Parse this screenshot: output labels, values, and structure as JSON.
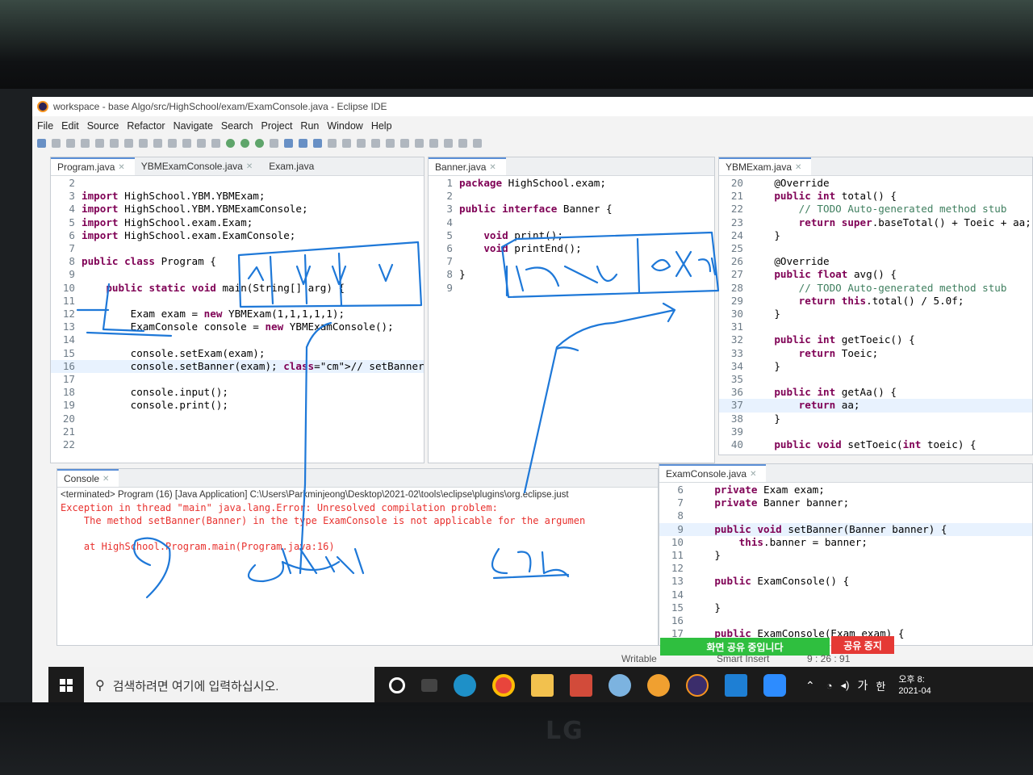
{
  "window": {
    "title": "workspace - base Algo/src/HighSchool/exam/ExamConsole.java - Eclipse IDE"
  },
  "menu": [
    "File",
    "Edit",
    "Source",
    "Refactor",
    "Navigate",
    "Search",
    "Project",
    "Run",
    "Window",
    "Help"
  ],
  "left_editor": {
    "tabs": [
      "Program.java",
      "YBMExamConsole.java",
      "Exam.java"
    ],
    "lines": [
      {
        "n": "2",
        "t": ""
      },
      {
        "n": "3",
        "t": "import HighSchool.YBM.YBMExam;"
      },
      {
        "n": "4",
        "t": "import HighSchool.YBM.YBMExamConsole;"
      },
      {
        "n": "5",
        "t": "import HighSchool.exam.Exam;"
      },
      {
        "n": "6",
        "t": "import HighSchool.exam.ExamConsole;"
      },
      {
        "n": "7",
        "t": ""
      },
      {
        "n": "8",
        "t": "public class Program {"
      },
      {
        "n": "9",
        "t": ""
      },
      {
        "n": "10",
        "t": "    public static void main(String[] arg) {"
      },
      {
        "n": "11",
        "t": ""
      },
      {
        "n": "12",
        "t": "        Exam exam = new YBMExam(1,1,1,1,1);"
      },
      {
        "n": "13",
        "t": "        ExamConsole console = new YBMExamConsole();"
      },
      {
        "n": "14",
        "t": ""
      },
      {
        "n": "15",
        "t": "        console.setExam(exam);"
      },
      {
        "n": "16",
        "t": "        console.setBanner(exam); // setBanner에 exam을"
      },
      {
        "n": "17",
        "t": ""
      },
      {
        "n": "18",
        "t": "        console.input();"
      },
      {
        "n": "19",
        "t": "        console.print();"
      },
      {
        "n": "20",
        "t": ""
      },
      {
        "n": "21",
        "t": ""
      },
      {
        "n": "22",
        "t": ""
      }
    ]
  },
  "mid_editor": {
    "tabs": [
      "Banner.java"
    ],
    "lines": [
      {
        "n": "1",
        "t": "package HighSchool.exam;"
      },
      {
        "n": "2",
        "t": ""
      },
      {
        "n": "3",
        "t": "public interface Banner {"
      },
      {
        "n": "4",
        "t": ""
      },
      {
        "n": "5",
        "t": "    void print();"
      },
      {
        "n": "6",
        "t": "    void printEnd();"
      },
      {
        "n": "7",
        "t": ""
      },
      {
        "n": "8",
        "t": "}"
      },
      {
        "n": "9",
        "t": ""
      }
    ]
  },
  "right_editor": {
    "tabs": [
      "YBMExam.java"
    ],
    "lines": [
      {
        "n": "20",
        "t": "    @Override"
      },
      {
        "n": "21",
        "t": "    public int total() {"
      },
      {
        "n": "22",
        "t": "        // TODO Auto-generated method stub"
      },
      {
        "n": "23",
        "t": "        return super.baseTotal() + Toeic + aa;"
      },
      {
        "n": "24",
        "t": "    }"
      },
      {
        "n": "25",
        "t": ""
      },
      {
        "n": "26",
        "t": "    @Override"
      },
      {
        "n": "27",
        "t": "    public float avg() {"
      },
      {
        "n": "28",
        "t": "        // TODO Auto-generated method stub"
      },
      {
        "n": "29",
        "t": "        return this.total() / 5.0f;"
      },
      {
        "n": "30",
        "t": "    }"
      },
      {
        "n": "31",
        "t": ""
      },
      {
        "n": "32",
        "t": "    public int getToeic() {"
      },
      {
        "n": "33",
        "t": "        return Toeic;"
      },
      {
        "n": "34",
        "t": "    }"
      },
      {
        "n": "35",
        "t": ""
      },
      {
        "n": "36",
        "t": "    public int getAa() {"
      },
      {
        "n": "37",
        "t": "        return aa;"
      },
      {
        "n": "38",
        "t": "    }"
      },
      {
        "n": "39",
        "t": ""
      },
      {
        "n": "40",
        "t": "    public void setToeic(int toeic) {"
      }
    ]
  },
  "console": {
    "tab": "Console",
    "header": "<terminated> Program (16) [Java Application] C:\\Users\\Parkminjeong\\Desktop\\2021-02\\tools\\eclipse\\plugins\\org.eclipse.just",
    "lines": [
      "Exception in thread \"main\" java.lang.Error: Unresolved compilation problem:",
      "    The method setBanner(Banner) in the type ExamConsole is not applicable for the argumen",
      "",
      "    at HighSchool.Program.main(Program.java:16)"
    ]
  },
  "bottom_editor": {
    "tabs": [
      "ExamConsole.java"
    ],
    "lines": [
      {
        "n": "6",
        "t": "    private Exam exam;"
      },
      {
        "n": "7",
        "t": "    private Banner banner;"
      },
      {
        "n": "8",
        "t": ""
      },
      {
        "n": "9",
        "t": "    public void setBanner(Banner banner) {"
      },
      {
        "n": "10",
        "t": "        this.banner = banner;"
      },
      {
        "n": "11",
        "t": "    }"
      },
      {
        "n": "12",
        "t": ""
      },
      {
        "n": "13",
        "t": "    public ExamConsole() {"
      },
      {
        "n": "14",
        "t": ""
      },
      {
        "n": "15",
        "t": "    }"
      },
      {
        "n": "16",
        "t": ""
      },
      {
        "n": "17",
        "t": "    public ExamConsole(Exam exam) {"
      }
    ]
  },
  "status": {
    "writable": "Writable",
    "insert": "Smart Insert",
    "position": "9 : 26 : 91"
  },
  "share": {
    "sharing": "화면 공유 중입니다",
    "stop": "공유 중지"
  },
  "taskbar": {
    "search_placeholder": "검색하려면 여기에 입력하십시오.",
    "clock_time": "오후 8:",
    "clock_date": "2021-04",
    "ime": "가",
    "lang": "한"
  },
  "brand": "LG",
  "ink_notes": [
    "Exam",
    "Con",
    "YBExam",
    "Exan"
  ]
}
